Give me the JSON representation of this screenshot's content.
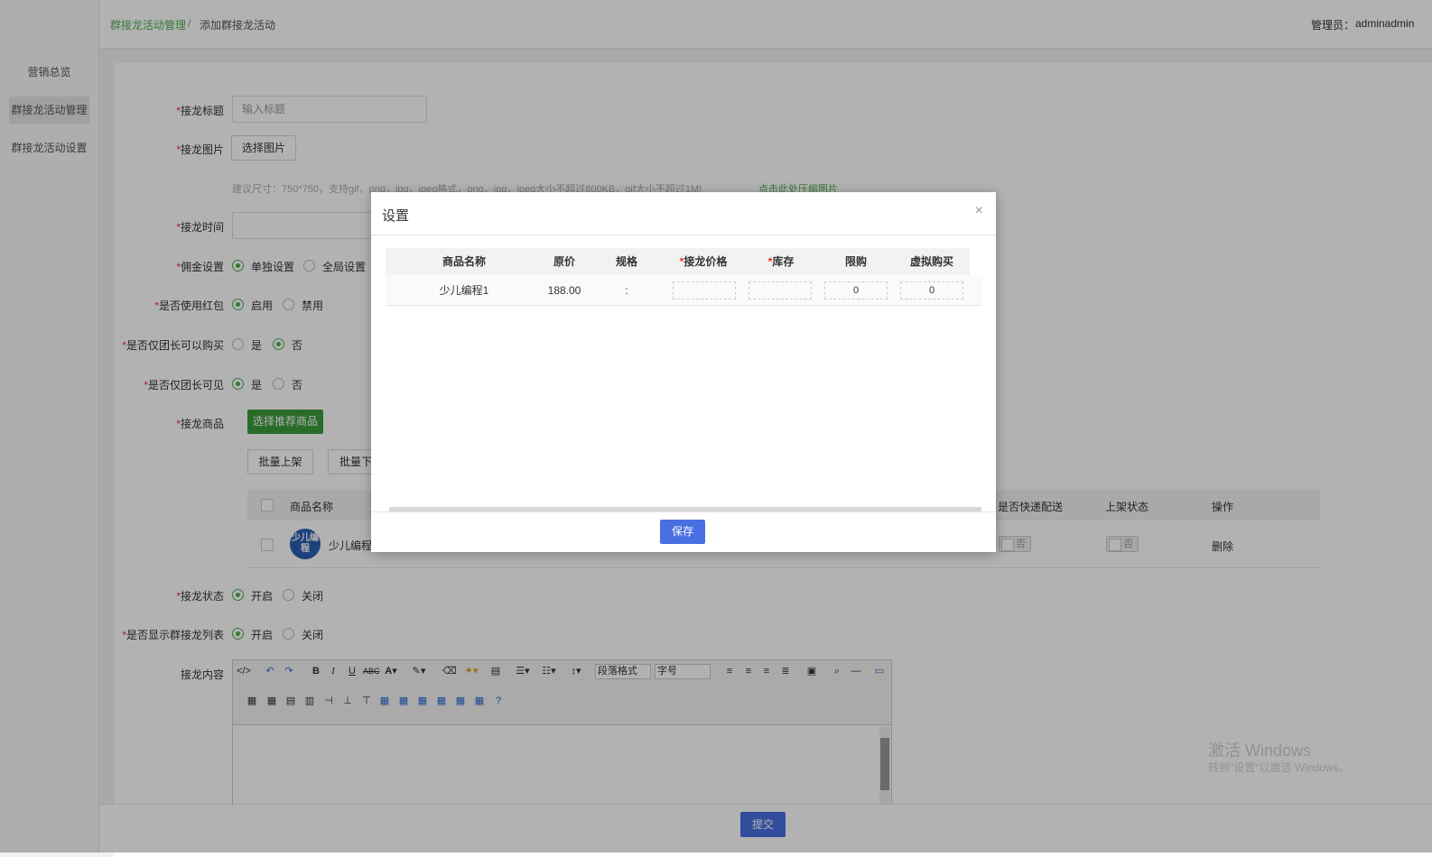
{
  "sidebar": {
    "items": [
      {
        "label": "营销总览"
      },
      {
        "label": "群接龙活动管理"
      },
      {
        "label": "群接龙活动设置"
      }
    ]
  },
  "header": {
    "breadcrumb_1": "群接龙活动管理",
    "breadcrumb_sep": "/",
    "breadcrumb_2": "添加群接龙活动",
    "admin_label": "管理员：",
    "admin_name": "adminadmin"
  },
  "form": {
    "title_label": "接龙标题",
    "title_placeholder": "输入标题",
    "image_label": "接龙图片",
    "image_button": "选择图片",
    "image_hint": "建议尺寸：750*750，支持gif，png，jpg，jpeg格式，png，jpg，jpeg大小不超过800KB，gif大小不超过1M!",
    "image_compress_link": "点击此处压缩图片",
    "time_label": "接龙时间",
    "price_label": "佣金设置",
    "price_options": [
      "单独设置",
      "全局设置"
    ],
    "redpack_label": "是否使用红包",
    "redpack_options": [
      "启用",
      "禁用"
    ],
    "leader_buy_label": "是否仅团长可以购买",
    "leader_buy_options": [
      "是",
      "否"
    ],
    "leader_visible_label": "是否仅团长可见",
    "leader_visible_options": [
      "是",
      "否"
    ],
    "goods_label": "接龙商品",
    "goods_button": "选择推荐商品",
    "batch_on": "批量上架",
    "batch_off": "批量下",
    "goods_table": {
      "col_name": "商品名称",
      "col_express": "是否快递配送",
      "col_status": "上架状态",
      "col_action": "操作",
      "row": {
        "name": "少儿编程",
        "avatar_text": "少儿编程",
        "express": "否",
        "status": "否",
        "action": "删除"
      }
    },
    "status_label": "接龙状态",
    "status_options": [
      "开启",
      "关闭"
    ],
    "show_list_label": "是否显示群接龙列表",
    "show_list_options": [
      "开启",
      "关闭"
    ],
    "content_label": "接龙内容",
    "editor": {
      "paragraph": "段落格式",
      "fontsize": "字号"
    },
    "submit": "提交",
    "required_mark": "*"
  },
  "modal": {
    "title": "设置",
    "close": "×",
    "headers": [
      "商品名称",
      "原价",
      "规格",
      "接龙价格",
      "库存",
      "限购",
      "虚拟购买"
    ],
    "row": {
      "name": "少儿编程1",
      "price": "188.00",
      "spec": ":",
      "group_price": "",
      "stock": "",
      "limit": "0",
      "virtual": "0"
    },
    "save": "保存"
  },
  "watermark": {
    "line1": "激活 Windows",
    "line2": "转到\"设置\"以激活 Windows。"
  },
  "colors": {
    "green": "#4caf50",
    "blue": "#4a6fe3",
    "dark_green_btn": "#3c9a3c"
  }
}
